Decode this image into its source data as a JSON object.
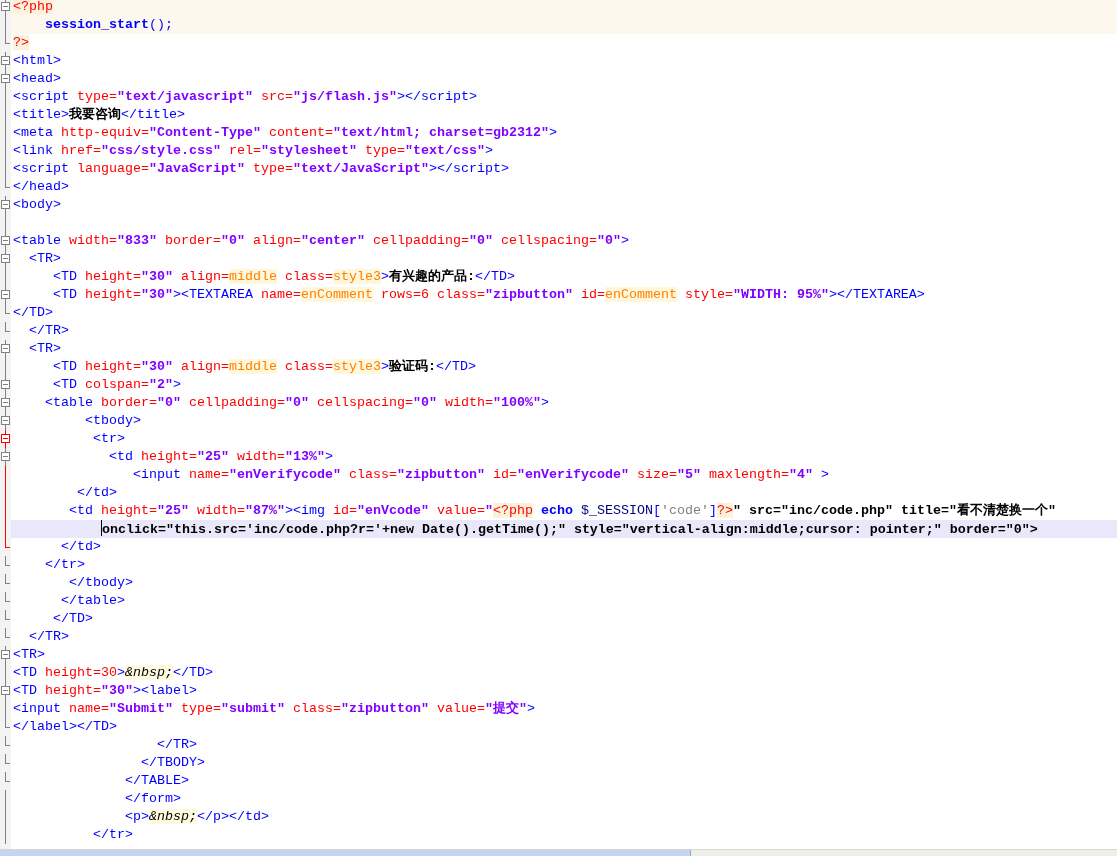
{
  "editor": {
    "lines": [
      {
        "kind": "php",
        "current": false,
        "fold": {
          "kind": "open",
          "active": false
        },
        "tokens": [
          {
            "kind": "php",
            "text": "<?php"
          }
        ]
      },
      {
        "kind": "php",
        "current": false,
        "fold": {
          "kind": "mid",
          "active": false
        },
        "tokens": [
          {
            "kind": "keyword",
            "text": "    session_start"
          },
          {
            "kind": "punct",
            "text": "();"
          }
        ]
      },
      {
        "kind": "html",
        "current": false,
        "fold": {
          "kind": "end",
          "active": false
        },
        "tokens": [
          {
            "kind": "php",
            "text": "?>"
          }
        ]
      },
      {
        "kind": "html",
        "current": false,
        "fold": {
          "kind": "open",
          "active": false
        },
        "tokens": [
          {
            "kind": "tag",
            "text": "<html>"
          }
        ]
      },
      {
        "kind": "html",
        "current": false,
        "fold": {
          "kind": "open",
          "active": false
        },
        "tokens": [
          {
            "kind": "tag",
            "text": "<head>"
          }
        ]
      },
      {
        "kind": "html",
        "current": false,
        "fold": {
          "kind": "mid",
          "active": false
        },
        "tokens": [
          {
            "kind": "tag",
            "text": "<script "
          },
          {
            "kind": "attr",
            "text": "type="
          },
          {
            "kind": "value",
            "text": "\"text/javascript\" "
          },
          {
            "kind": "attr",
            "text": "src="
          },
          {
            "kind": "value",
            "text": "\"js/flash.js\""
          },
          {
            "kind": "tag",
            "text": "></script>"
          }
        ]
      },
      {
        "kind": "html",
        "current": false,
        "fold": {
          "kind": "mid",
          "active": false
        },
        "tokens": [
          {
            "kind": "tag",
            "text": "<title>"
          },
          {
            "kind": "text",
            "text": "我要咨询"
          },
          {
            "kind": "tag",
            "text": "</title>"
          }
        ]
      },
      {
        "kind": "html",
        "current": false,
        "fold": {
          "kind": "mid",
          "active": false
        },
        "tokens": [
          {
            "kind": "tag",
            "text": "<meta "
          },
          {
            "kind": "attr",
            "text": "http-equiv="
          },
          {
            "kind": "value",
            "text": "\"Content-Type\" "
          },
          {
            "kind": "attr",
            "text": "content="
          },
          {
            "kind": "value",
            "text": "\"text/html; charset=gb2312\""
          },
          {
            "kind": "tag",
            "text": ">"
          }
        ]
      },
      {
        "kind": "html",
        "current": false,
        "fold": {
          "kind": "mid",
          "active": false
        },
        "tokens": [
          {
            "kind": "tag",
            "text": "<link "
          },
          {
            "kind": "attr",
            "text": "href="
          },
          {
            "kind": "value",
            "text": "\"css/style.css\" "
          },
          {
            "kind": "attr",
            "text": "rel="
          },
          {
            "kind": "value",
            "text": "\"stylesheet\" "
          },
          {
            "kind": "attr",
            "text": "type="
          },
          {
            "kind": "value",
            "text": "\"text/css\""
          },
          {
            "kind": "tag",
            "text": ">"
          }
        ]
      },
      {
        "kind": "html",
        "current": false,
        "fold": {
          "kind": "mid",
          "active": false
        },
        "tokens": [
          {
            "kind": "tag",
            "text": "<script "
          },
          {
            "kind": "attr",
            "text": "language="
          },
          {
            "kind": "value",
            "text": "\"JavaScript\" "
          },
          {
            "kind": "attr",
            "text": "type="
          },
          {
            "kind": "value",
            "text": "\"text/JavaScript\""
          },
          {
            "kind": "tag",
            "text": "></script>"
          }
        ]
      },
      {
        "kind": "html",
        "current": false,
        "fold": {
          "kind": "end",
          "active": false
        },
        "tokens": [
          {
            "kind": "tag",
            "text": "</head>"
          }
        ]
      },
      {
        "kind": "html",
        "current": false,
        "fold": {
          "kind": "open",
          "active": false
        },
        "tokens": [
          {
            "kind": "tag",
            "text": "<body>"
          }
        ]
      },
      {
        "kind": "html",
        "current": false,
        "fold": {
          "kind": "mid",
          "active": false
        }
      },
      {
        "kind": "html",
        "current": false,
        "fold": {
          "kind": "open",
          "active": false
        },
        "tokens": [
          {
            "kind": "tag",
            "text": "<table "
          },
          {
            "kind": "attr",
            "text": "width="
          },
          {
            "kind": "value",
            "text": "\"833\" "
          },
          {
            "kind": "attr",
            "text": "border="
          },
          {
            "kind": "value",
            "text": "\"0\" "
          },
          {
            "kind": "attr",
            "text": "align="
          },
          {
            "kind": "value",
            "text": "\"center\" "
          },
          {
            "kind": "attr",
            "text": "cellpadding="
          },
          {
            "kind": "value",
            "text": "\"0\" "
          },
          {
            "kind": "attr",
            "text": "cellspacing="
          },
          {
            "kind": "value",
            "text": "\"0\""
          },
          {
            "kind": "tag",
            "text": ">"
          }
        ]
      },
      {
        "kind": "html",
        "current": false,
        "fold": {
          "kind": "open",
          "active": false
        },
        "tokens": [
          {
            "kind": "tag",
            "text": "  <TR>"
          }
        ]
      },
      {
        "kind": "html",
        "current": false,
        "fold": {
          "kind": "mid",
          "active": false
        },
        "tokens": [
          {
            "kind": "tag",
            "text": "     <TD "
          },
          {
            "kind": "attr",
            "text": "height="
          },
          {
            "kind": "value",
            "text": "\"30\" "
          },
          {
            "kind": "attr",
            "text": "align="
          },
          {
            "kind": "bare",
            "text": "middle"
          },
          {
            "kind": "attr",
            "text": " class="
          },
          {
            "kind": "bare",
            "text": "style3"
          },
          {
            "kind": "tag",
            "text": ">"
          },
          {
            "kind": "text",
            "text": "有兴趣的产品:"
          },
          {
            "kind": "tag",
            "text": "</TD>"
          }
        ]
      },
      {
        "kind": "html",
        "current": false,
        "fold": {
          "kind": "open",
          "active": false
        },
        "tokens": [
          {
            "kind": "tag",
            "text": "     <TD "
          },
          {
            "kind": "attr",
            "text": "height="
          },
          {
            "kind": "value",
            "text": "\"30\""
          },
          {
            "kind": "tag",
            "text": "><TEXTAREA "
          },
          {
            "kind": "attr",
            "text": "name="
          },
          {
            "kind": "bare",
            "text": "enComment"
          },
          {
            "kind": "attr",
            "text": " rows=6 class="
          },
          {
            "kind": "value",
            "text": "\"zipbutton\" "
          },
          {
            "kind": "attr",
            "text": "id="
          },
          {
            "kind": "bare",
            "text": "enComment"
          },
          {
            "kind": "attr",
            "text": " style="
          },
          {
            "kind": "value",
            "text": "\"WIDTH: 95%\""
          },
          {
            "kind": "tag",
            "text": "></TEXTAREA>"
          }
        ]
      },
      {
        "kind": "html",
        "current": false,
        "fold": {
          "kind": "end",
          "active": false
        },
        "tokens": [
          {
            "kind": "tag",
            "text": "</TD>"
          }
        ]
      },
      {
        "kind": "html",
        "current": false,
        "fold": {
          "kind": "end",
          "active": false
        },
        "tokens": [
          {
            "kind": "tag",
            "text": "  </TR>"
          }
        ]
      },
      {
        "kind": "html",
        "current": false,
        "fold": {
          "kind": "open",
          "active": false
        },
        "tokens": [
          {
            "kind": "tag",
            "text": "  <TR>"
          }
        ]
      },
      {
        "kind": "html",
        "current": false,
        "fold": {
          "kind": "mid",
          "active": false
        },
        "tokens": [
          {
            "kind": "tag",
            "text": "     <TD "
          },
          {
            "kind": "attr",
            "text": "height="
          },
          {
            "kind": "value",
            "text": "\"30\" "
          },
          {
            "kind": "attr",
            "text": "align="
          },
          {
            "kind": "bare",
            "text": "middle"
          },
          {
            "kind": "attr",
            "text": " class="
          },
          {
            "kind": "bare",
            "text": "style3"
          },
          {
            "kind": "tag",
            "text": ">"
          },
          {
            "kind": "text",
            "text": "验证码:"
          },
          {
            "kind": "tag",
            "text": "</TD>"
          }
        ]
      },
      {
        "kind": "html",
        "current": false,
        "fold": {
          "kind": "open",
          "active": false
        },
        "tokens": [
          {
            "kind": "tag",
            "text": "     <TD "
          },
          {
            "kind": "attr",
            "text": "colspan="
          },
          {
            "kind": "value",
            "text": "\"2\""
          },
          {
            "kind": "tag",
            "text": ">"
          }
        ]
      },
      {
        "kind": "html",
        "current": false,
        "fold": {
          "kind": "open",
          "active": false
        },
        "tokens": [
          {
            "kind": "tag",
            "text": "    <table "
          },
          {
            "kind": "attr",
            "text": "border="
          },
          {
            "kind": "value",
            "text": "\"0\" "
          },
          {
            "kind": "attr",
            "text": "cellpadding="
          },
          {
            "kind": "value",
            "text": "\"0\" "
          },
          {
            "kind": "attr",
            "text": "cellspacing="
          },
          {
            "kind": "value",
            "text": "\"0\" "
          },
          {
            "kind": "attr",
            "text": "width="
          },
          {
            "kind": "value",
            "text": "\"100%\""
          },
          {
            "kind": "tag",
            "text": ">"
          }
        ]
      },
      {
        "kind": "html",
        "current": false,
        "fold": {
          "kind": "open",
          "active": false
        },
        "tokens": [
          {
            "kind": "tag",
            "text": "         <tbody>"
          }
        ]
      },
      {
        "kind": "html",
        "current": false,
        "fold": {
          "kind": "open",
          "active": true
        },
        "tokens": [
          {
            "kind": "tag",
            "text": "          <tr>"
          }
        ]
      },
      {
        "kind": "html",
        "current": false,
        "fold": {
          "kind": "open",
          "active": false
        },
        "tokens": [
          {
            "kind": "tag",
            "text": "            <td "
          },
          {
            "kind": "attr",
            "text": "height="
          },
          {
            "kind": "value",
            "text": "\"25\" "
          },
          {
            "kind": "attr",
            "text": "width="
          },
          {
            "kind": "value",
            "text": "\"13%\""
          },
          {
            "kind": "tag",
            "text": ">"
          }
        ]
      },
      {
        "kind": "html",
        "current": false,
        "fold": {
          "kind": "mid",
          "active": true
        },
        "tokens": [
          {
            "kind": "tag",
            "text": "               <input "
          },
          {
            "kind": "attr",
            "text": "name="
          },
          {
            "kind": "value",
            "text": "\"enVerifycode\" "
          },
          {
            "kind": "attr",
            "text": "class="
          },
          {
            "kind": "value",
            "text": "\"zipbutton\" "
          },
          {
            "kind": "attr",
            "text": "id="
          },
          {
            "kind": "value",
            "text": "\"enVerifycode\" "
          },
          {
            "kind": "attr",
            "text": "size="
          },
          {
            "kind": "value",
            "text": "\"5\" "
          },
          {
            "kind": "attr",
            "text": "maxlength="
          },
          {
            "kind": "value",
            "text": "\"4\" "
          },
          {
            "kind": "tag",
            "text": ">"
          }
        ]
      },
      {
        "kind": "html",
        "current": false,
        "fold": {
          "kind": "mid",
          "active": true
        },
        "tokens": [
          {
            "kind": "tag",
            "text": "        </td>"
          }
        ]
      },
      {
        "kind": "html",
        "current": false,
        "fold": {
          "kind": "mid",
          "active": true
        },
        "tokens": [
          {
            "kind": "tag",
            "text": "       <td "
          },
          {
            "kind": "attr",
            "text": "height="
          },
          {
            "kind": "value",
            "text": "\"25\" "
          },
          {
            "kind": "attr",
            "text": "width="
          },
          {
            "kind": "value",
            "text": "\"87%\""
          },
          {
            "kind": "tag",
            "text": "><img "
          },
          {
            "kind": "attr",
            "text": "id="
          },
          {
            "kind": "value",
            "text": "\"enVcode\" "
          },
          {
            "kind": "attr",
            "text": "value="
          },
          {
            "kind": "value",
            "text": "\""
          },
          {
            "kind": "php",
            "text": "<?php"
          },
          {
            "kind": "keyword",
            "text": " echo "
          },
          {
            "kind": "var",
            "text": "$_SESSION"
          },
          {
            "kind": "punct",
            "text": "["
          },
          {
            "kind": "string",
            "text": "'code'"
          },
          {
            "kind": "punct",
            "text": "]"
          },
          {
            "kind": "php",
            "text": "?>"
          },
          {
            "kind": "plain",
            "text": "\" src=\"inc/code.php\" title=\"看不清楚换一个\""
          }
        ]
      },
      {
        "kind": "html",
        "current": true,
        "caret": true,
        "fold": {
          "kind": "mid",
          "active": true
        },
        "tokens": [
          {
            "kind": "plain",
            "text": "           onclick=\"this.src='inc/code.php?r='+new Date().getTime();\" style=\"vertical-align:middle;cursor: pointer;\" border=\"0\">"
          }
        ]
      },
      {
        "kind": "html",
        "current": false,
        "fold": {
          "kind": "end",
          "active": true
        },
        "tokens": [
          {
            "kind": "tag",
            "text": "      </td>"
          }
        ]
      },
      {
        "kind": "html",
        "current": false,
        "fold": {
          "kind": "end",
          "active": false
        },
        "tokens": [
          {
            "kind": "tag",
            "text": "    </tr>"
          }
        ]
      },
      {
        "kind": "html",
        "current": false,
        "fold": {
          "kind": "end",
          "active": false
        },
        "tokens": [
          {
            "kind": "tag",
            "text": "       </tbody>"
          }
        ]
      },
      {
        "kind": "html",
        "current": false,
        "fold": {
          "kind": "end",
          "active": false
        },
        "tokens": [
          {
            "kind": "tag",
            "text": "      </table>"
          }
        ]
      },
      {
        "kind": "html",
        "current": false,
        "fold": {
          "kind": "end",
          "active": false
        },
        "tokens": [
          {
            "kind": "tag",
            "text": "     </TD>"
          }
        ]
      },
      {
        "kind": "html",
        "current": false,
        "fold": {
          "kind": "end",
          "active": false
        },
        "tokens": [
          {
            "kind": "tag",
            "text": "  </TR>"
          }
        ]
      },
      {
        "kind": "html",
        "current": false,
        "fold": {
          "kind": "open",
          "active": false
        },
        "tokens": [
          {
            "kind": "tag",
            "text": "<TR>"
          }
        ]
      },
      {
        "kind": "html",
        "current": false,
        "fold": {
          "kind": "mid",
          "active": false
        },
        "tokens": [
          {
            "kind": "tag",
            "text": "<TD "
          },
          {
            "kind": "attr",
            "text": "height=30"
          },
          {
            "kind": "tag",
            "text": ">"
          },
          {
            "kind": "entity",
            "text": "&nbsp;"
          },
          {
            "kind": "tag",
            "text": "</TD>"
          }
        ]
      },
      {
        "kind": "html",
        "current": false,
        "fold": {
          "kind": "open",
          "active": false
        },
        "tokens": [
          {
            "kind": "tag",
            "text": "<TD "
          },
          {
            "kind": "attr",
            "text": "height="
          },
          {
            "kind": "value",
            "text": "\"30\""
          },
          {
            "kind": "tag",
            "text": "><label>"
          }
        ]
      },
      {
        "kind": "html",
        "current": false,
        "fold": {
          "kind": "mid",
          "active": false
        },
        "tokens": [
          {
            "kind": "tag",
            "text": "<input "
          },
          {
            "kind": "attr",
            "text": "name="
          },
          {
            "kind": "value",
            "text": "\"Submit\" "
          },
          {
            "kind": "attr",
            "text": "type="
          },
          {
            "kind": "value",
            "text": "\"submit\" "
          },
          {
            "kind": "attr",
            "text": "class="
          },
          {
            "kind": "value",
            "text": "\"zipbutton\" "
          },
          {
            "kind": "attr",
            "text": "value="
          },
          {
            "kind": "value",
            "text": "\"提交\""
          },
          {
            "kind": "tag",
            "text": ">"
          }
        ]
      },
      {
        "kind": "html",
        "current": false,
        "fold": {
          "kind": "end",
          "active": false
        },
        "tokens": [
          {
            "kind": "tag",
            "text": "</label></TD>"
          }
        ]
      },
      {
        "kind": "html",
        "current": false,
        "fold": {
          "kind": "end",
          "active": false
        },
        "tokens": [
          {
            "kind": "tag",
            "text": "                  </TR>"
          }
        ]
      },
      {
        "kind": "html",
        "current": false,
        "fold": {
          "kind": "end",
          "active": false
        },
        "tokens": [
          {
            "kind": "tag",
            "text": "                </TBODY>"
          }
        ]
      },
      {
        "kind": "html",
        "current": false,
        "fold": {
          "kind": "end",
          "active": false
        },
        "tokens": [
          {
            "kind": "tag",
            "text": "              </TABLE>"
          }
        ]
      },
      {
        "kind": "html",
        "current": false,
        "fold": {
          "kind": "mid",
          "active": false
        },
        "tokens": [
          {
            "kind": "tag",
            "text": "              </form>"
          }
        ]
      },
      {
        "kind": "html",
        "current": false,
        "fold": {
          "kind": "mid",
          "active": false
        },
        "tokens": [
          {
            "kind": "tag",
            "text": "              <p>"
          },
          {
            "kind": "entity",
            "text": "&nbsp;"
          },
          {
            "kind": "tag",
            "text": "</p></td>"
          }
        ]
      },
      {
        "kind": "html",
        "current": false,
        "fold": {
          "kind": "mid",
          "active": false
        },
        "tokens": [
          {
            "kind": "tag",
            "text": "          </tr>"
          }
        ]
      }
    ]
  }
}
